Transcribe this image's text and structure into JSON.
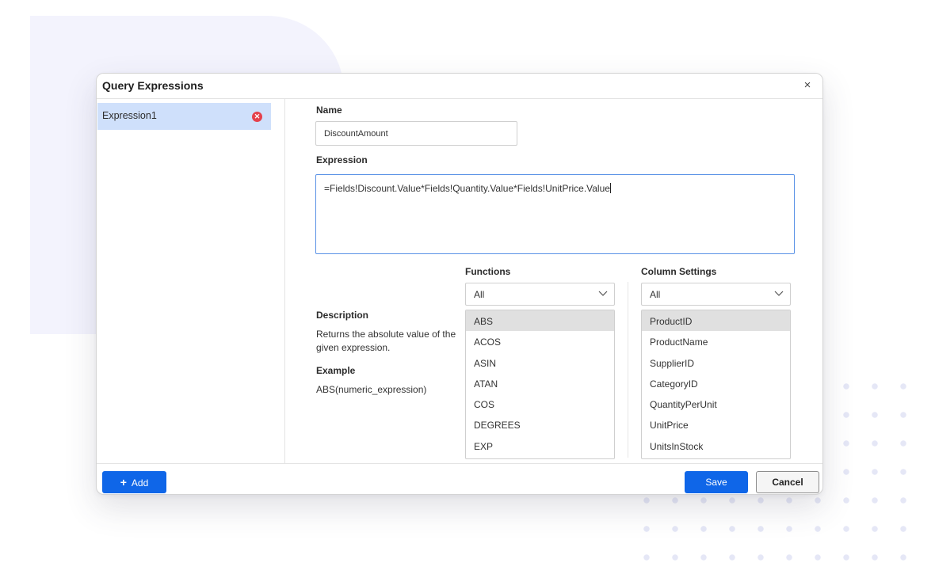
{
  "dialog": {
    "title": "Query Expressions",
    "close_glyph": "×"
  },
  "sidebar": {
    "items": [
      {
        "label": "Expression1",
        "selected": true,
        "remove_icon": "remove-circle-icon"
      }
    ]
  },
  "form": {
    "name_label": "Name",
    "name_value": "DiscountAmount",
    "expression_label": "Expression",
    "expression_value": "=Fields!Discount.Value*Fields!Quantity.Value*Fields!UnitPrice.Value"
  },
  "description": {
    "heading": "Description",
    "text": "Returns the absolute value of the given expression.",
    "example_heading": "Example",
    "example_text": "ABS(numeric_expression)"
  },
  "functions": {
    "label": "Functions",
    "filter_value": "All",
    "items": [
      "ABS",
      "ACOS",
      "ASIN",
      "ATAN",
      "COS",
      "DEGREES",
      "EXP"
    ],
    "selected": "ABS"
  },
  "column_settings": {
    "label": "Column Settings",
    "filter_value": "All",
    "items": [
      "ProductID",
      "ProductName",
      "SupplierID",
      "CategoryID",
      "QuantityPerUnit",
      "UnitPrice",
      "UnitsInStock"
    ],
    "selected": "ProductID"
  },
  "footer": {
    "add_label": "Add",
    "save_label": "Save",
    "cancel_label": "Cancel"
  },
  "colors": {
    "accent": "#0f66e8",
    "selected_row": "#cfe0fb",
    "remove_badge": "#e5414c",
    "focus_border": "#5b93e6"
  }
}
